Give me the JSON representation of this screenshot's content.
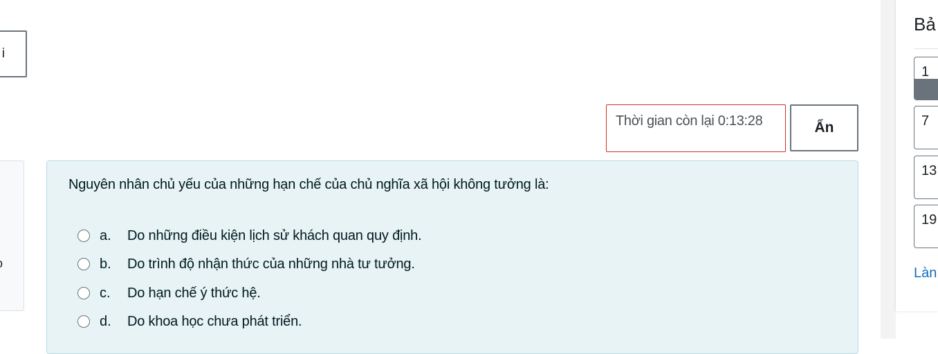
{
  "left_button": {
    "label": "i"
  },
  "left_panel": {
    "text": "o"
  },
  "timer": {
    "text": "Thời gian còn lại 0:13:28"
  },
  "hide_button": {
    "label": "Ẩn"
  },
  "question": {
    "text": "Nguyên nhân chủ yếu của những hạn chế của chủ nghĩa xã hội không tưởng là:",
    "answers": [
      {
        "letter": "a.",
        "text": "Do những điều kiện lịch sử khách quan quy định."
      },
      {
        "letter": "b.",
        "text": "Do trình độ nhận thức của những nhà tư tưởng."
      },
      {
        "letter": "c.",
        "text": "Do hạn chế ý thức hệ."
      },
      {
        "letter": "d.",
        "text": "Do khoa học chưa phát triển."
      }
    ]
  },
  "nav": {
    "title": "Bả",
    "items": [
      {
        "number": "1",
        "answered": true
      },
      {
        "number": "7",
        "answered": false
      },
      {
        "number": "13",
        "answered": false
      },
      {
        "number": "19",
        "answered": false
      }
    ],
    "link": "Làn"
  },
  "colors": {
    "question_bg": "#e7f3f5",
    "timer_border": "#ca3120",
    "link": "#0f6cbf",
    "answered_fill": "#6a737b"
  }
}
